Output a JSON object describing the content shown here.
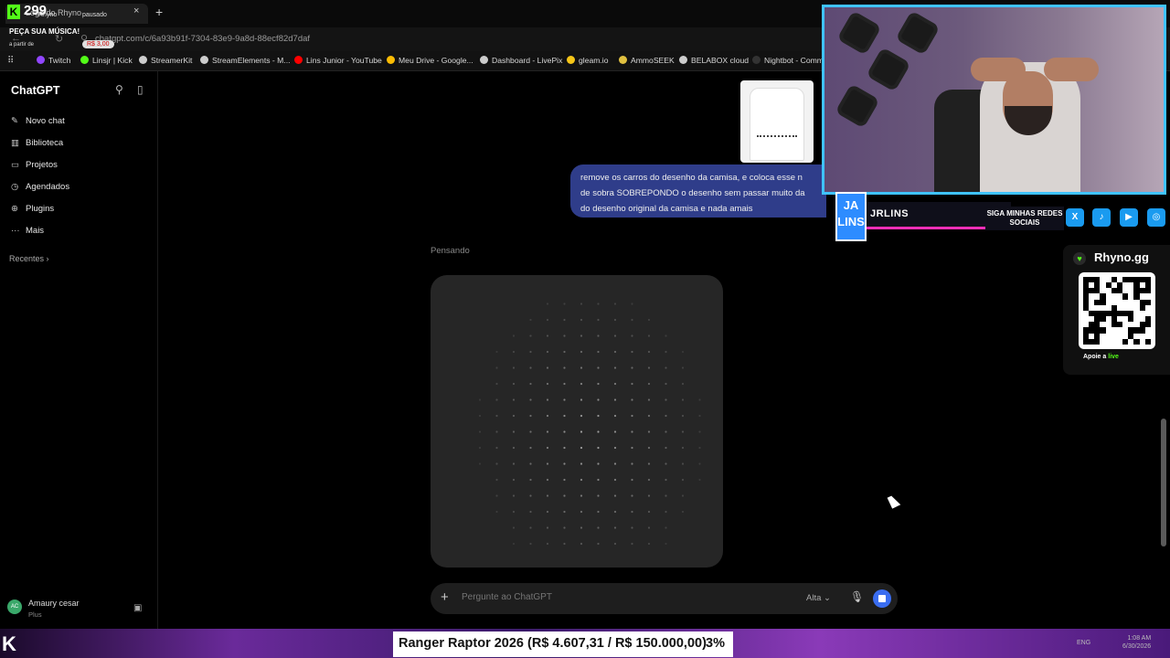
{
  "browser": {
    "tab_title": "Logo do Rhyno",
    "url": "chatgpt.com/c/6a93b91f-7304-83e9-9a8d-88ecf82d7daf",
    "bookmarks": [
      {
        "label": "Twitch",
        "color": "#9146ff"
      },
      {
        "label": "Linsjr | Kick",
        "color": "#53fc18"
      },
      {
        "label": "StreamerKit",
        "color": "#cccccc"
      },
      {
        "label": "StreamElements - M...",
        "color": "#cccccc"
      },
      {
        "label": "Lins Junior - YouTube",
        "color": "#ff0000"
      },
      {
        "label": "Meu Drive - Google...",
        "color": "#fbbc04"
      },
      {
        "label": "Dashboard - LivePix",
        "color": "#cccccc"
      },
      {
        "label": "gleam.io",
        "color": "#f5c518"
      },
      {
        "label": "AmmoSEEK",
        "color": "#e0c040"
      },
      {
        "label": "BELABOX cloud",
        "color": "#cccccc"
      },
      {
        "label": "Nightbot - Comm",
        "color": "#222222"
      }
    ]
  },
  "stream_overlay": {
    "viewer_count": "299",
    "logo_letter": "K",
    "now_playing": "Rhyno",
    "paused": "pausado",
    "request_music": "PEÇA SUA MÚSICA!",
    "from_label": "a partir de",
    "price": "R$ 3,00"
  },
  "sidebar": {
    "brand": "ChatGPT",
    "items": [
      {
        "label": "Novo chat",
        "icon": "edit-icon"
      },
      {
        "label": "Biblioteca",
        "icon": "library-icon"
      },
      {
        "label": "Projetos",
        "icon": "folder-icon"
      },
      {
        "label": "Agendados",
        "icon": "clock-icon"
      },
      {
        "label": "Plugins",
        "icon": "plugin-icon"
      },
      {
        "label": "Mais",
        "icon": "more-icon"
      }
    ],
    "recents_label": "Recentes",
    "user": {
      "initials": "AC",
      "name": "Amaury cesar",
      "plan": "Plus"
    }
  },
  "chat": {
    "user_message_lines": [
      "remove os carros do desenho da camisa, e coloca esse n",
      "de sobra SOBREPONDO o desenho sem passar muito da",
      "do desenho original da camisa e nada amais"
    ],
    "thinking_label": "Pensando",
    "composer_placeholder": "Pergunte ao ChatGPT",
    "model_label": "Alta"
  },
  "webcam_overlay": {
    "badge_text": "JA LINS",
    "streamer_name": "JRLINS",
    "slogan": "SIGA MINHAS REDES SOCIAIS",
    "socials": [
      "X",
      "TikTok",
      "YouTube",
      "Instagram"
    ]
  },
  "rhyno_widget": {
    "title": "Rhyno.gg",
    "cta_prefix": "Apoie a",
    "cta_highlight": "live"
  },
  "ticker": {
    "text": "Ranger Raptor 2026 (R$ 4.607,31 / R$ 150.000,00)",
    "percent": "3%",
    "progress": 0.03
  },
  "taskbar": {
    "time": "1:08 AM",
    "date": "6/30/2026",
    "lang": "ENG"
  }
}
